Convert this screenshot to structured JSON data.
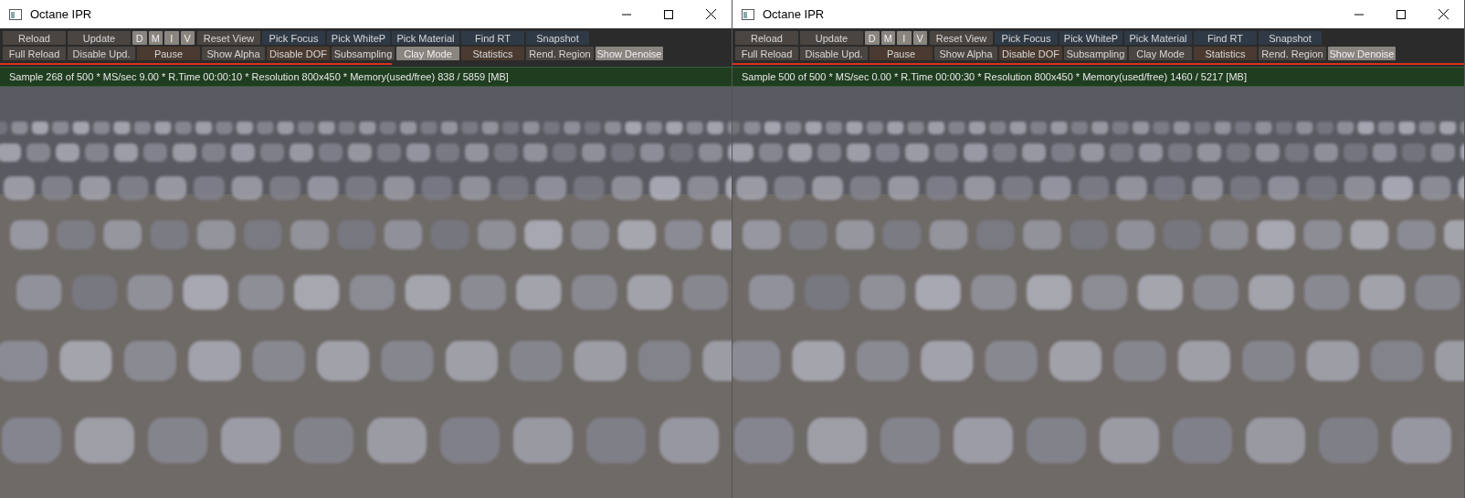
{
  "windows": [
    {
      "title": "Octane IPR",
      "toolbar": {
        "row_1": [
          {
            "label": "Reload",
            "kind": "plain",
            "selected": false
          },
          {
            "label": "Update",
            "kind": "plain",
            "selected": false
          },
          {
            "kind": "toggles",
            "items": [
              {
                "label": "D",
                "selected": true
              },
              {
                "label": "M",
                "selected": true
              },
              {
                "label": "I",
                "selected": true
              },
              {
                "label": "V",
                "selected": true
              }
            ]
          },
          {
            "label": "Reset View",
            "kind": "plain",
            "selected": false
          },
          {
            "label": "Pick Focus",
            "kind": "blue",
            "selected": false
          },
          {
            "label": "Pick WhiteP",
            "kind": "blue",
            "selected": false
          },
          {
            "label": "Pick Material",
            "kind": "blue",
            "selected": false
          },
          {
            "label": "Find RT",
            "kind": "blue",
            "selected": false
          },
          {
            "label": "Snapshot",
            "kind": "blue",
            "selected": false
          }
        ],
        "row_2": [
          {
            "label": "Full Reload",
            "kind": "plain",
            "selected": false
          },
          {
            "label": "Disable Upd.",
            "kind": "plain",
            "selected": false
          },
          {
            "label": "Pause",
            "kind": "warm",
            "selected": false
          },
          {
            "label": "Show Alpha",
            "kind": "plain",
            "selected": false
          },
          {
            "label": "Disable DOF",
            "kind": "warm",
            "selected": false
          },
          {
            "label": "Subsampling",
            "kind": "plain",
            "selected": false
          },
          {
            "label": "Clay Mode",
            "kind": "plain",
            "selected": true
          },
          {
            "label": "Statistics",
            "kind": "warm",
            "selected": false
          },
          {
            "label": "Rend. Region",
            "kind": "plain",
            "selected": false
          },
          {
            "label": "Show Denoise",
            "kind": "plain",
            "selected": true
          }
        ]
      },
      "progress": {
        "level": 0.535
      },
      "status": "Sample 268 of 500 * MS/sec 9.00 * R.Time 00:00:10 * Resolution 800x450 * Memory(used/free) 838 / 5859 [MB]"
    },
    {
      "title": "Octane IPR",
      "toolbar": {
        "row_1": [
          {
            "label": "Reload",
            "kind": "plain",
            "selected": false
          },
          {
            "label": "Update",
            "kind": "plain",
            "selected": false
          },
          {
            "kind": "toggles",
            "items": [
              {
                "label": "D",
                "selected": true
              },
              {
                "label": "M",
                "selected": true
              },
              {
                "label": "I",
                "selected": true
              },
              {
                "label": "V",
                "selected": true
              }
            ]
          },
          {
            "label": "Reset View",
            "kind": "plain",
            "selected": false
          },
          {
            "label": "Pick Focus",
            "kind": "blue",
            "selected": false
          },
          {
            "label": "Pick WhiteP",
            "kind": "blue",
            "selected": false
          },
          {
            "label": "Pick Material",
            "kind": "blue",
            "selected": false
          },
          {
            "label": "Find RT",
            "kind": "blue",
            "selected": false
          },
          {
            "label": "Snapshot",
            "kind": "blue",
            "selected": false
          }
        ],
        "row_2": [
          {
            "label": "Full Reload",
            "kind": "plain",
            "selected": false
          },
          {
            "label": "Disable Upd.",
            "kind": "plain",
            "selected": false
          },
          {
            "label": "Pause",
            "kind": "warm",
            "selected": false
          },
          {
            "label": "Show Alpha",
            "kind": "plain",
            "selected": false
          },
          {
            "label": "Disable DOF",
            "kind": "warm",
            "selected": false
          },
          {
            "label": "Subsampling",
            "kind": "plain",
            "selected": false
          },
          {
            "label": "Clay Mode",
            "kind": "plain",
            "selected": false
          },
          {
            "label": "Statistics",
            "kind": "warm",
            "selected": false
          },
          {
            "label": "Rend. Region",
            "kind": "plain",
            "selected": false
          },
          {
            "label": "Show Denoise",
            "kind": "plain",
            "selected": true
          }
        ]
      },
      "progress": {
        "level": 1
      },
      "status": "Sample 500 of 500 * MS/sec 0.00 * R.Time 00:00:30 * Resolution 800x450 * Memory(used/free) 1460 / 5217 [MB]"
    }
  ]
}
